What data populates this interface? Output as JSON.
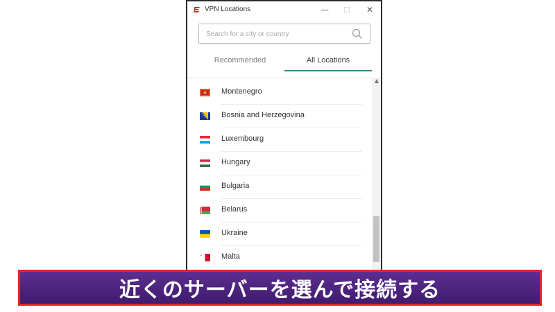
{
  "window": {
    "title": "VPN Locations",
    "minimize_icon": "minimize-icon",
    "maximize_icon": "maximize-icon",
    "close_icon": "close-icon",
    "minimize_glyph": "—",
    "maximize_glyph": "☐",
    "close_glyph": "✕"
  },
  "search": {
    "placeholder": "Search for a city or country",
    "value": ""
  },
  "tabs": [
    {
      "label": "Recommended",
      "active": false
    },
    {
      "label": "All Locations",
      "active": true
    }
  ],
  "locations": [
    {
      "name": "Montenegro",
      "flag": "montenegro-flag"
    },
    {
      "name": "Bosnia and Herzegovina",
      "flag": "bosnia-flag"
    },
    {
      "name": "Luxembourg",
      "flag": "luxembourg-flag"
    },
    {
      "name": "Hungary",
      "flag": "hungary-flag"
    },
    {
      "name": "Bulgaria",
      "flag": "bulgaria-flag"
    },
    {
      "name": "Belarus",
      "flag": "belarus-flag"
    },
    {
      "name": "Ukraine",
      "flag": "ukraine-flag"
    },
    {
      "name": "Malta",
      "flag": "malta-flag"
    }
  ],
  "banner": {
    "text": "近くのサーバーを選んで接続する"
  },
  "colors": {
    "accent": "#3a8a7a",
    "brand_red": "#da2d34",
    "banner_purple": "#4a2178",
    "banner_border": "#e8242a"
  }
}
